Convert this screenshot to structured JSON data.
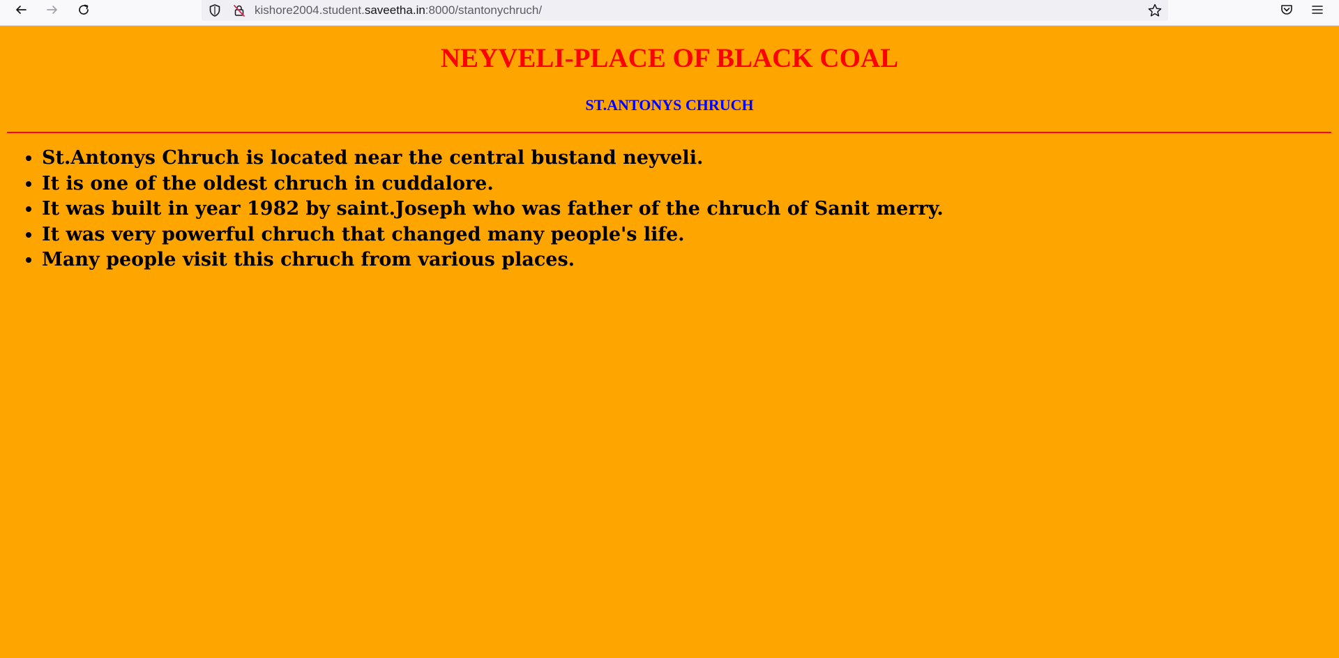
{
  "browser": {
    "url": {
      "prefix": "kishore2004.student.",
      "host": "saveetha.in",
      "suffix": ":8000/stantonychruch/"
    },
    "icons": {
      "back": "back-arrow-icon",
      "forward": "forward-arrow-icon",
      "reload": "reload-icon",
      "tracking": "shield-icon",
      "insecure": "insecure-lock-icon",
      "bookmark": "star-icon",
      "pocket": "pocket-icon",
      "menu": "hamburger-menu-icon"
    }
  },
  "page": {
    "background": "#ffa500",
    "title": "NEYVELI-PLACE OF BLACK COAL",
    "title_color": "#ff0000",
    "subtitle": "ST.ANTONYS CHRUCH",
    "subtitle_color": "#0000ff",
    "divider_color": "#ff0000",
    "facts": [
      "St.Antonys Chruch is located near the central bustand neyveli.",
      "It is one of the oldest chruch in cuddalore.",
      "It was built in year 1982 by saint.Joseph who was father of the chruch of Sanit merry.",
      "It was very powerful chruch that changed many people's life.",
      "Many people visit this chruch from various places."
    ]
  }
}
